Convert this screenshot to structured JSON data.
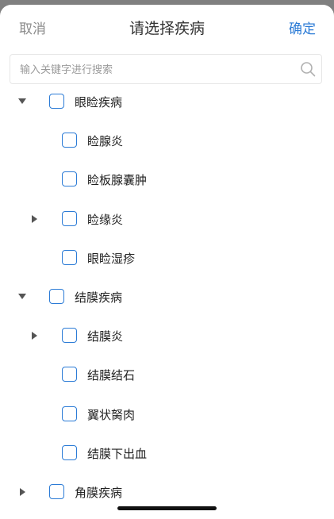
{
  "header": {
    "cancel_label": "取消",
    "title": "请选择疾病",
    "confirm_label": "确定"
  },
  "search": {
    "placeholder": "输入关键字进行搜索",
    "icon": "search-icon"
  },
  "tree": [
    {
      "label": "眼睑疾病",
      "level": 0,
      "expander": "expanded",
      "checked": false
    },
    {
      "label": "睑腺炎",
      "level": 1,
      "expander": "none",
      "checked": false
    },
    {
      "label": "睑板腺囊肿",
      "level": 1,
      "expander": "none",
      "checked": false
    },
    {
      "label": "睑缘炎",
      "level": 1,
      "expander": "collapsed",
      "checked": false
    },
    {
      "label": "眼睑湿疹",
      "level": 1,
      "expander": "none",
      "checked": false
    },
    {
      "label": "结膜疾病",
      "level": 0,
      "expander": "expanded",
      "checked": false
    },
    {
      "label": "结膜炎",
      "level": 1,
      "expander": "collapsed",
      "checked": false
    },
    {
      "label": "结膜结石",
      "level": 1,
      "expander": "none",
      "checked": false
    },
    {
      "label": "翼状胬肉",
      "level": 1,
      "expander": "none",
      "checked": false
    },
    {
      "label": "结膜下出血",
      "level": 1,
      "expander": "none",
      "checked": false
    },
    {
      "label": "角膜疾病",
      "level": 0,
      "expander": "collapsed",
      "checked": false
    }
  ],
  "colors": {
    "accent": "#2b7bd6",
    "muted_text": "#8a8a8a",
    "arrow": "#555555"
  }
}
